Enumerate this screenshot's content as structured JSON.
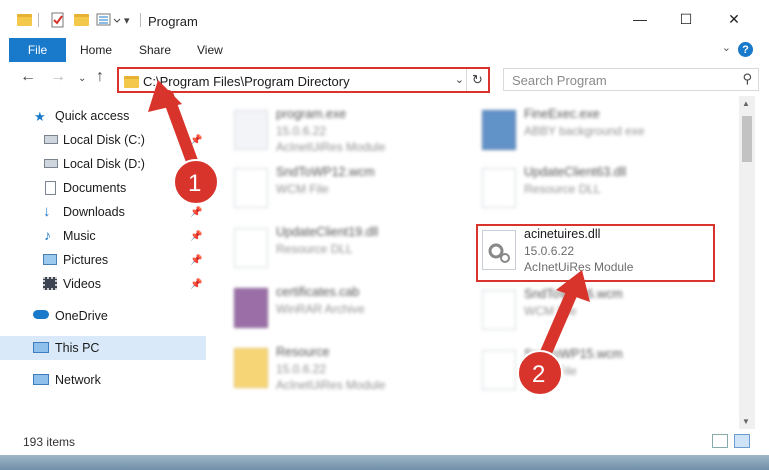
{
  "window": {
    "title": "Program",
    "controls": {
      "minimize": "—",
      "maximize": "☐",
      "close": "✕"
    }
  },
  "ribbon": {
    "file": "File",
    "tabs": [
      "Home",
      "Share",
      "View"
    ],
    "help": "?"
  },
  "address": {
    "path": "C:\\Program Files\\Program Directory",
    "dropdown": "⌄",
    "refresh": "↻"
  },
  "search": {
    "placeholder": "Search Program",
    "icon": "search-icon"
  },
  "nav": {
    "items": [
      {
        "label": "Quick access",
        "icon": "star-icon"
      },
      {
        "label": "Local Disk (C:)",
        "icon": "drive-icon",
        "pinned": true
      },
      {
        "label": "Local Disk (D:)",
        "icon": "drive-icon",
        "pinned": false
      },
      {
        "label": "Documents",
        "icon": "documents-icon",
        "pinned": true
      },
      {
        "label": "Downloads",
        "icon": "download-icon",
        "pinned": true
      },
      {
        "label": "Music",
        "icon": "music-icon",
        "pinned": true
      },
      {
        "label": "Pictures",
        "icon": "pictures-icon",
        "pinned": true
      },
      {
        "label": "Videos",
        "icon": "videos-icon",
        "pinned": true
      },
      {
        "label": "OneDrive",
        "icon": "cloud-icon"
      },
      {
        "label": "This PC",
        "icon": "computer-icon",
        "selected": true
      },
      {
        "label": "Network",
        "icon": "network-icon"
      }
    ]
  },
  "files": [
    {
      "name": "program.exe",
      "line2": "15.0.6.22",
      "line3": "AcInetUiRes Module"
    },
    {
      "name": "FineExec.exe",
      "line2": "ABBY background exe",
      "line3": ""
    },
    {
      "name": "SndToWP12.wcm",
      "line2": "WCM File",
      "line3": ""
    },
    {
      "name": "UpdateClient63.dll",
      "line2": "Resource DLL",
      "line3": ""
    },
    {
      "name": "UpdateClient19.dll",
      "line2": "Resource DLL",
      "line3": ""
    },
    {
      "name": "acinetuires.dll",
      "line2": "15.0.6.22",
      "line3": "AcInetUiRes Module"
    },
    {
      "name": "certificates.cab",
      "line2": "WinRAR Archive",
      "line3": ""
    },
    {
      "name": "SndToWP16.wcm",
      "line2": "WCM File",
      "line3": ""
    },
    {
      "name": "Resource",
      "line2": "15.0.6.22",
      "line3": "AcInetUiRes Module"
    },
    {
      "name": "SndToWP15.wcm",
      "line2": "WCM File",
      "line3": ""
    }
  ],
  "status": {
    "count": "193 items"
  },
  "annotations": {
    "step1": "1",
    "step2": "2",
    "color": "#d9342b"
  }
}
